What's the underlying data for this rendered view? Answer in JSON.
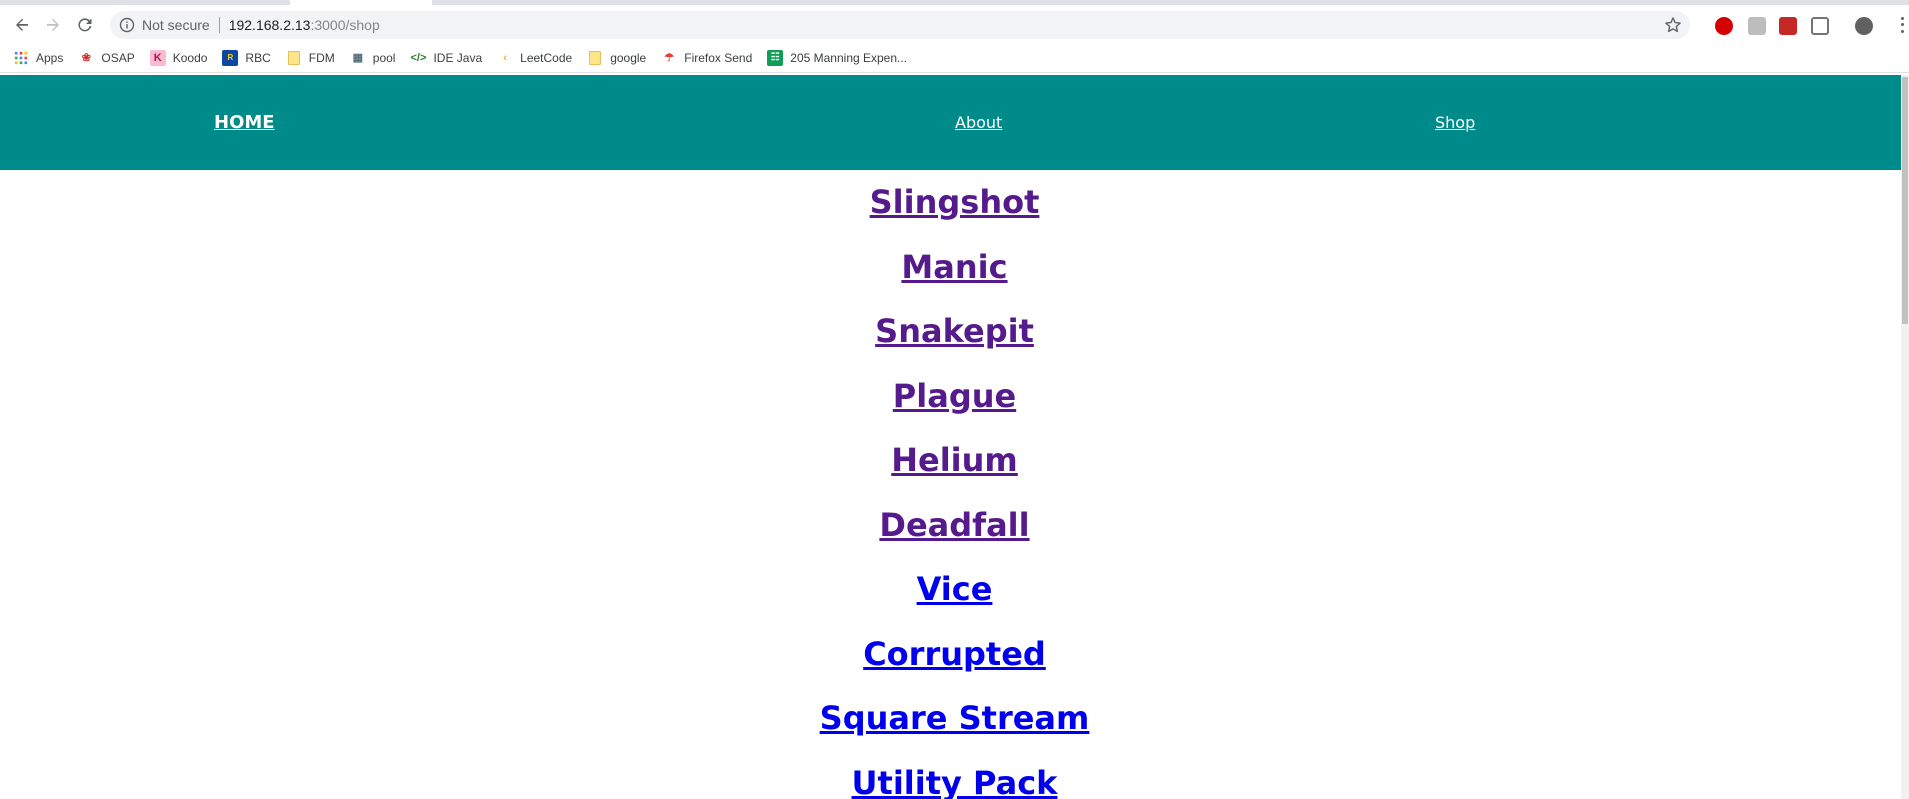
{
  "browser": {
    "security_label": "Not secure",
    "url_host": "192.168.2.13",
    "url_path": ":3000/shop",
    "bookmarks": [
      {
        "label": "Apps",
        "icon": "apps-grid-icon"
      },
      {
        "label": "OSAP",
        "icon": "maple-leaf-icon"
      },
      {
        "label": "Koodo",
        "icon": "koodo-icon"
      },
      {
        "label": "RBC",
        "icon": "rbc-icon"
      },
      {
        "label": "FDM",
        "icon": "folder-icon"
      },
      {
        "label": "pool",
        "icon": "pool-icon"
      },
      {
        "label": "IDE Java",
        "icon": "code-icon"
      },
      {
        "label": "LeetCode",
        "icon": "leetcode-icon"
      },
      {
        "label": "google",
        "icon": "folder-icon"
      },
      {
        "label": "Firefox Send",
        "icon": "firefox-send-icon"
      },
      {
        "label": "205 Manning Expen...",
        "icon": "sheets-icon"
      }
    ]
  },
  "navbar": {
    "bg_color": "#008b8b",
    "home": "HOME",
    "about": "About",
    "shop": "Shop"
  },
  "products": [
    {
      "name": "Slingshot",
      "visited": true
    },
    {
      "name": "Manic",
      "visited": true
    },
    {
      "name": "Snakepit",
      "visited": true
    },
    {
      "name": "Plague",
      "visited": true
    },
    {
      "name": "Helium",
      "visited": true
    },
    {
      "name": "Deadfall",
      "visited": true
    },
    {
      "name": "Vice",
      "visited": false
    },
    {
      "name": "Corrupted",
      "visited": false
    },
    {
      "name": "Square Stream",
      "visited": false
    },
    {
      "name": "Utility Pack",
      "visited": false
    }
  ],
  "colors": {
    "visited_link": "#551a8b",
    "unvisited_link": "#0000ee"
  }
}
